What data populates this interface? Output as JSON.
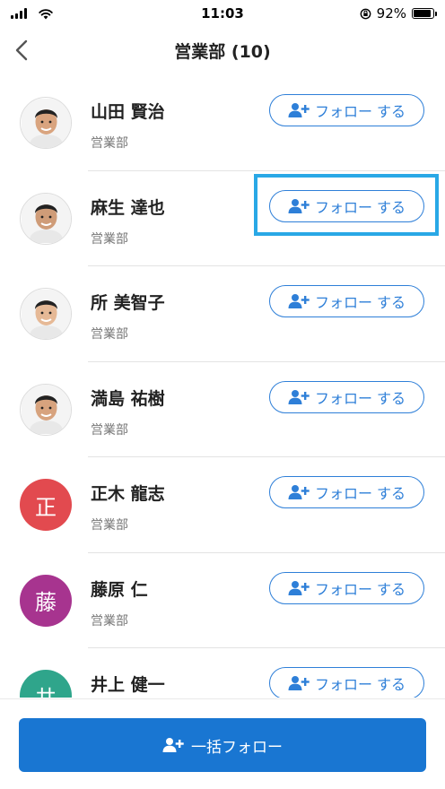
{
  "status_bar": {
    "time": "11:03",
    "battery_percent": "92%",
    "battery_level": 0.92
  },
  "nav": {
    "title": "営業部 (10)"
  },
  "follow_label": "フォロー する",
  "people": [
    {
      "name": "山田 賢治",
      "dept": "営業部",
      "avatar_type": "photo",
      "photo_tone": "#d9a47f"
    },
    {
      "name": "麻生 達也",
      "dept": "営業部",
      "avatar_type": "photo",
      "photo_tone": "#cf9c78"
    },
    {
      "name": "所 美智子",
      "dept": "営業部",
      "avatar_type": "photo",
      "photo_tone": "#e6b996"
    },
    {
      "name": "満島 祐樹",
      "dept": "営業部",
      "avatar_type": "photo",
      "photo_tone": "#d7a37e"
    },
    {
      "name": "正木 龍志",
      "dept": "営業部",
      "avatar_type": "initial",
      "initial": "正",
      "color": "#e24a4f"
    },
    {
      "name": "藤原 仁",
      "dept": "営業部",
      "avatar_type": "initial",
      "initial": "藤",
      "color": "#a7348f"
    },
    {
      "name": "井上 健一",
      "dept": "営業部",
      "avatar_type": "initial",
      "initial": "井",
      "color": "#2fa58b"
    }
  ],
  "highlighted_row": 1,
  "bulk_button": {
    "label": "一括フォロー"
  },
  "colors": {
    "accent": "#2e7fd8",
    "primary_button": "#1976d2",
    "highlight": "#29a8e6"
  }
}
